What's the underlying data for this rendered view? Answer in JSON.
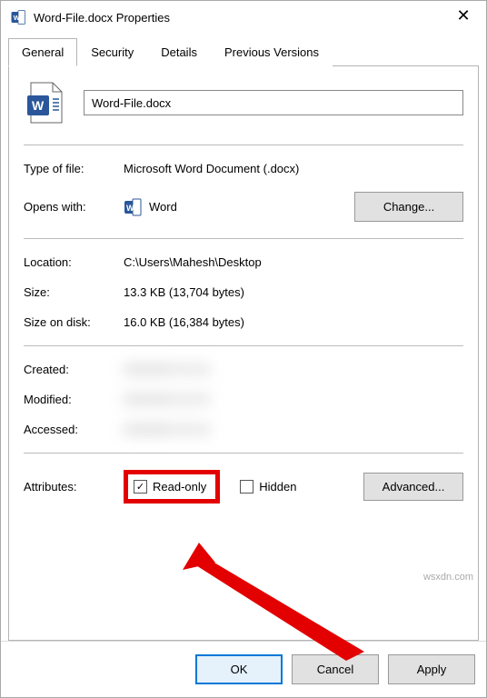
{
  "window": {
    "title": "Word-File.docx Properties"
  },
  "tabs": {
    "general": "General",
    "security": "Security",
    "details": "Details",
    "previous": "Previous Versions"
  },
  "filename": "Word-File.docx",
  "rows": {
    "type_label": "Type of file:",
    "type_value": "Microsoft Word Document (.docx)",
    "opens_label": "Opens with:",
    "opens_value": "Word",
    "change_btn": "Change...",
    "location_label": "Location:",
    "location_value": "C:\\Users\\Mahesh\\Desktop",
    "size_label": "Size:",
    "size_value": "13.3 KB (13,704 bytes)",
    "sizedisk_label": "Size on disk:",
    "sizedisk_value": "16.0 KB (16,384 bytes)",
    "created_label": "Created:",
    "created_value": "00000000 00 00",
    "modified_label": "Modified:",
    "modified_value": "00000000 00 00",
    "accessed_label": "Accessed:",
    "accessed_value": "00000000 00 00",
    "attributes_label": "Attributes:",
    "readonly_label": "Read-only",
    "readonly_checked": true,
    "hidden_label": "Hidden",
    "hidden_checked": false,
    "advanced_btn": "Advanced..."
  },
  "footer": {
    "ok": "OK",
    "cancel": "Cancel",
    "apply": "Apply"
  },
  "watermark": "wsxdn.com"
}
